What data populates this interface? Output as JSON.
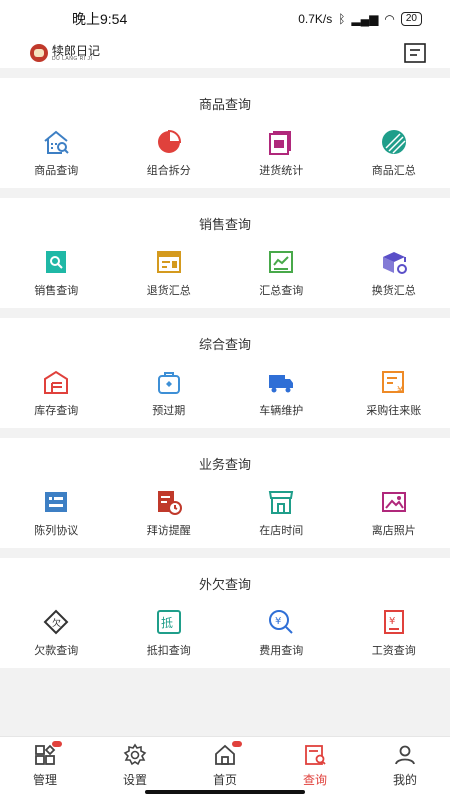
{
  "status": {
    "time": "晚上9:54",
    "network": "0.7K/s",
    "battery": "20"
  },
  "app": {
    "logo_cn": "犊郎日记",
    "logo_en": "DU LANG RI JI"
  },
  "sections": [
    {
      "title": "商品查询",
      "items": [
        {
          "label": "商品查询",
          "icon": "house-search-icon",
          "color": "#3d7fc4"
        },
        {
          "label": "组合拆分",
          "icon": "pie-icon",
          "color": "#e0413c"
        },
        {
          "label": "进货统计",
          "icon": "purchase-doc-icon",
          "color": "#b0287b"
        },
        {
          "label": "商品汇总",
          "icon": "stripe-circle-icon",
          "color": "#1f9e8a"
        }
      ]
    },
    {
      "title": "销售查询",
      "items": [
        {
          "label": "销售查询",
          "icon": "doc-search-icon",
          "color": "#1fb8a6"
        },
        {
          "label": "退货汇总",
          "icon": "return-window-icon",
          "color": "#d49a1e"
        },
        {
          "label": "汇总查询",
          "icon": "line-chart-icon",
          "color": "#48a94a"
        },
        {
          "label": "换货汇总",
          "icon": "box-exchange-icon",
          "color": "#5a4fc8"
        }
      ]
    },
    {
      "title": "综合查询",
      "items": [
        {
          "label": "库存查询",
          "icon": "warehouse-icon",
          "color": "#e0413c"
        },
        {
          "label": "预过期",
          "icon": "bag-icon",
          "color": "#3d8fd6"
        },
        {
          "label": "车辆维护",
          "icon": "truck-icon",
          "color": "#2f6fd6"
        },
        {
          "label": "采购往来账",
          "icon": "ledger-yen-icon",
          "color": "#ee8a26"
        }
      ]
    },
    {
      "title": "业务查询",
      "items": [
        {
          "label": "陈列协议",
          "icon": "display-board-icon",
          "color": "#3d7fc4"
        },
        {
          "label": "拜访提醒",
          "icon": "visit-clock-icon",
          "color": "#c0392b"
        },
        {
          "label": "在店时间",
          "icon": "store-icon",
          "color": "#1f9e8a"
        },
        {
          "label": "离店照片",
          "icon": "photo-icon",
          "color": "#b0287b"
        }
      ]
    },
    {
      "title": "外欠查询",
      "items": [
        {
          "label": "欠款查询",
          "icon": "debt-tag-icon",
          "color": "#333333"
        },
        {
          "label": "抵扣查询",
          "icon": "deduct-icon",
          "color": "#1f9e8a"
        },
        {
          "label": "费用查询",
          "icon": "fee-search-icon",
          "color": "#2f6fd6"
        },
        {
          "label": "工资查询",
          "icon": "salary-icon",
          "color": "#e0413c"
        }
      ]
    }
  ],
  "tabs": [
    {
      "label": "管理",
      "icon": "grid-manage-icon",
      "badge": true,
      "active": false
    },
    {
      "label": "设置",
      "icon": "gear-icon",
      "badge": false,
      "active": false
    },
    {
      "label": "首页",
      "icon": "home-icon",
      "badge": true,
      "active": false
    },
    {
      "label": "查询",
      "icon": "query-icon",
      "badge": false,
      "active": true
    },
    {
      "label": "我的",
      "icon": "user-icon",
      "badge": false,
      "active": false
    }
  ],
  "colors": {
    "accent": "#e0413c"
  }
}
